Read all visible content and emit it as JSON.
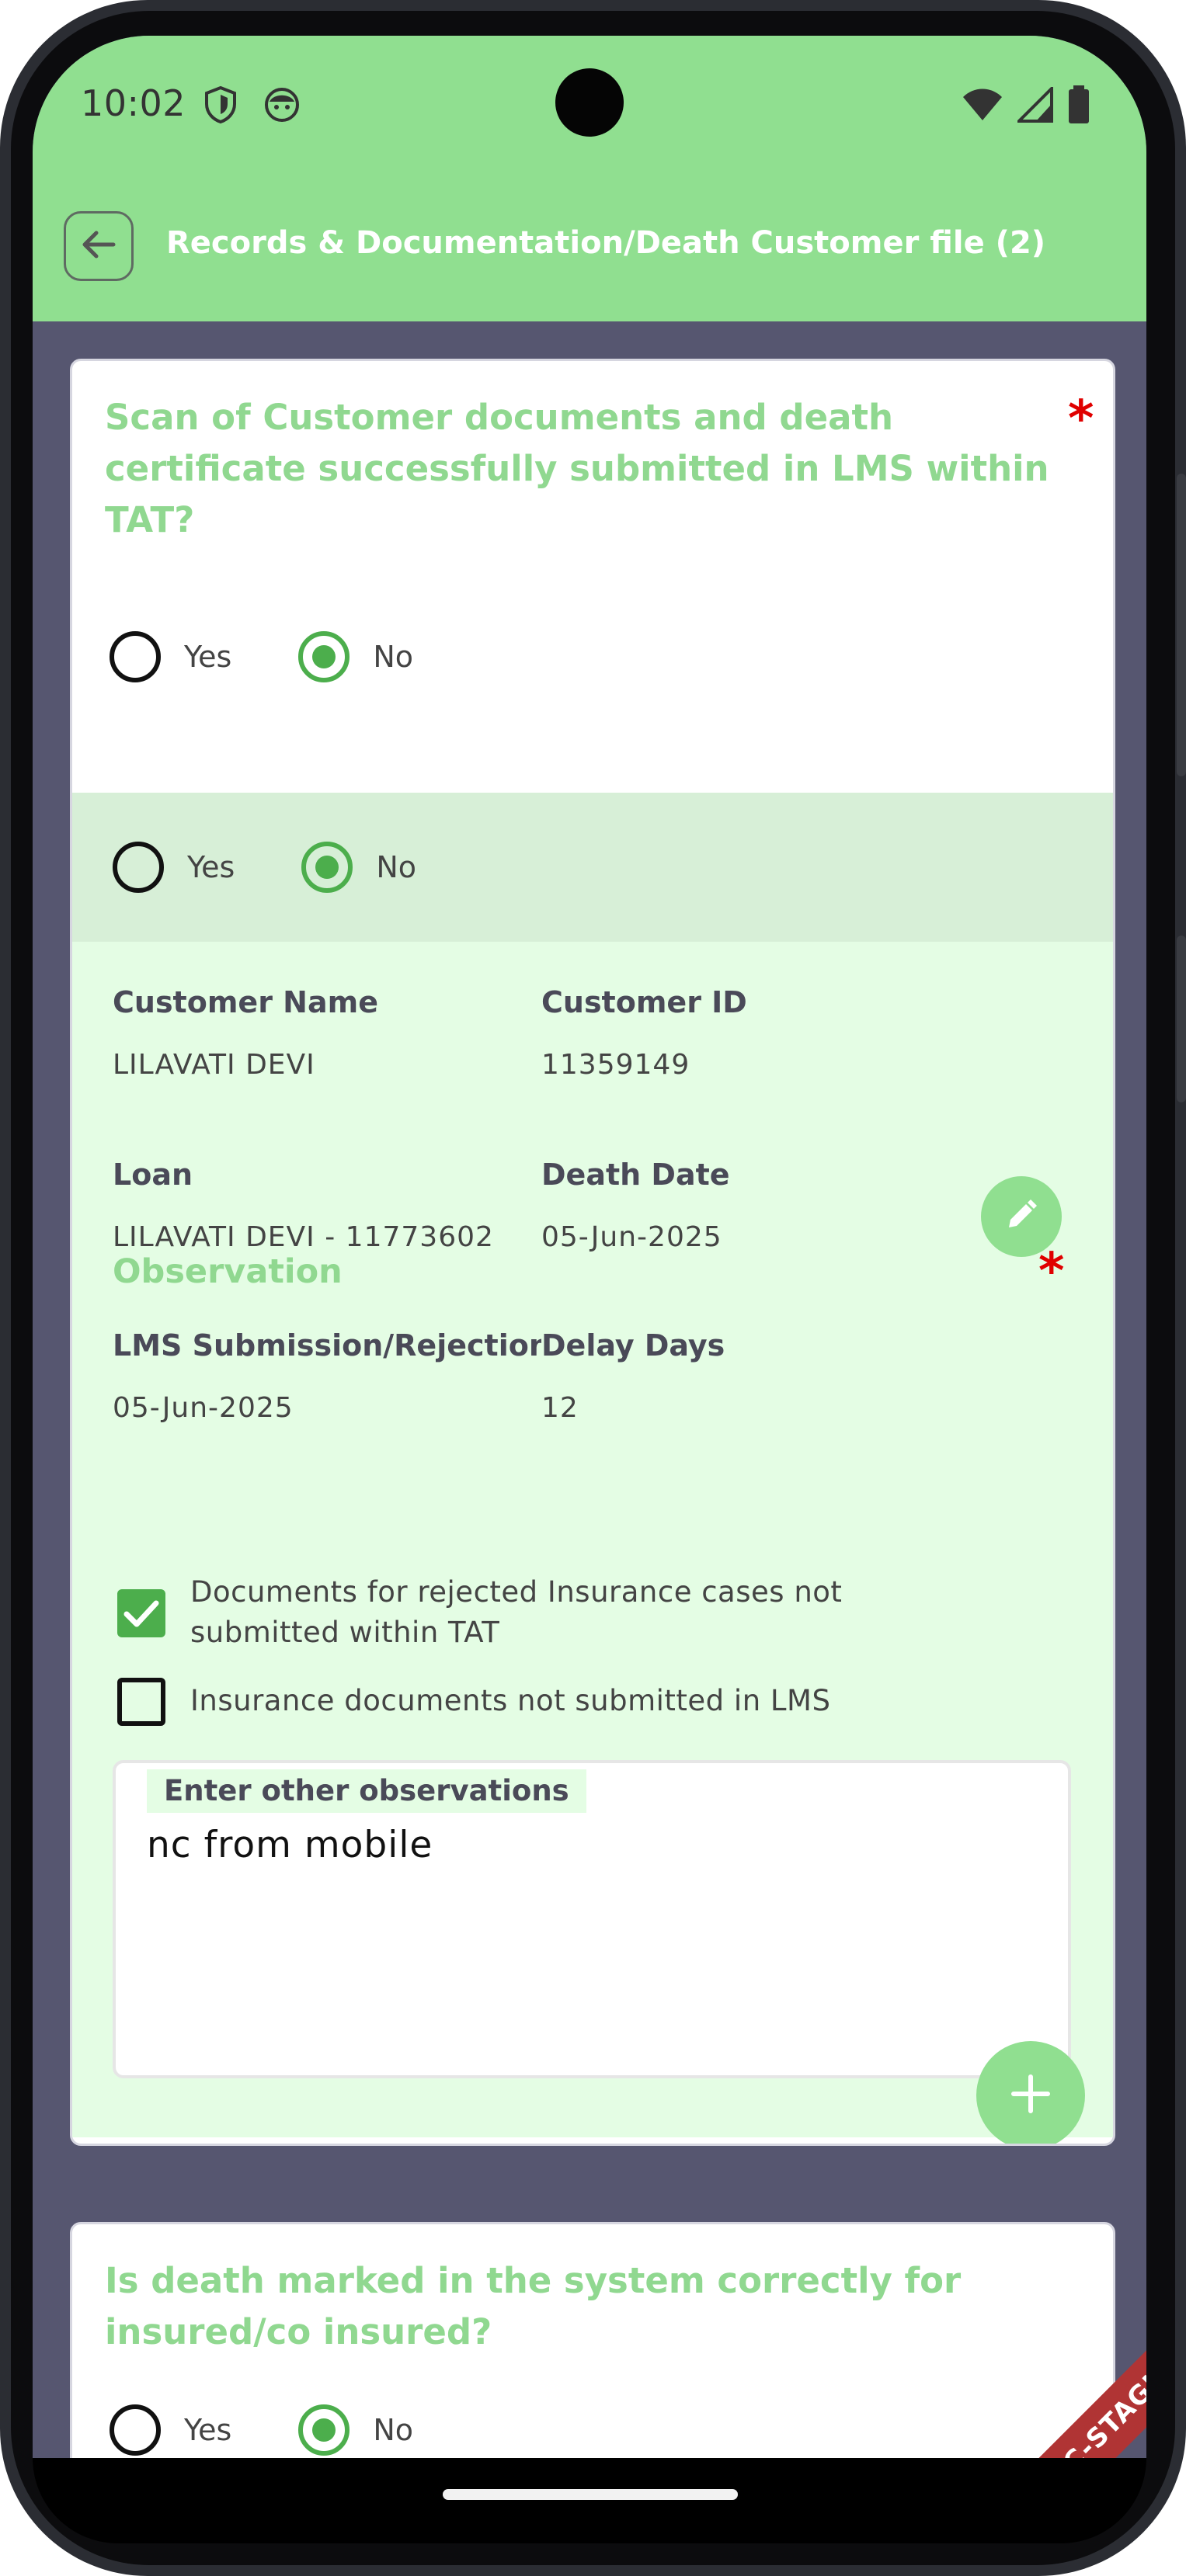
{
  "status_bar": {
    "time": "10:02"
  },
  "app_bar": {
    "title": "Records & Documentation/Death Customer file (2)"
  },
  "card1": {
    "question": "Scan of Customer documents and death certificate successfully submitted in LMS within TAT?",
    "required_mark": "*",
    "options": {
      "yes": "Yes",
      "no": "No",
      "selected": "No"
    },
    "answer": {
      "yes": "Yes",
      "no": "No",
      "selected": "No"
    },
    "details": {
      "customer_name_label": "Customer Name",
      "customer_name": "LILAVATI DEVI",
      "customer_id_label": "Customer ID",
      "customer_id": "11359149",
      "loan_label": "Loan",
      "loan": "LILAVATI DEVI - 11773602",
      "death_date_label": "Death Date",
      "death_date": "05-Jun-2025",
      "lms_label": "LMS Submission/Rejection…",
      "lms_date": "05-Jun-2025",
      "delay_label": "Delay Days",
      "delay_days": "12"
    },
    "observation": {
      "title": "Observation",
      "required_mark": "*",
      "items": [
        {
          "label": "Documents for rejected Insurance cases not submitted within TAT",
          "checked": true
        },
        {
          "label": "Insurance documents not submitted in LMS",
          "checked": false
        }
      ],
      "other_label": "Enter other observations",
      "other_value": "nc from mobile"
    }
  },
  "card2": {
    "question": "Is death marked in the system correctly for insured/co insured?",
    "options": {
      "yes": "Yes",
      "no": "No",
      "selected": "No"
    }
  },
  "env_badge": "C-STAGING",
  "colors": {
    "app_bar": "#90df90",
    "accent": "#4cae4c",
    "background": "#565670",
    "required": "#e00000",
    "detail_bg": "#e4fde4"
  }
}
